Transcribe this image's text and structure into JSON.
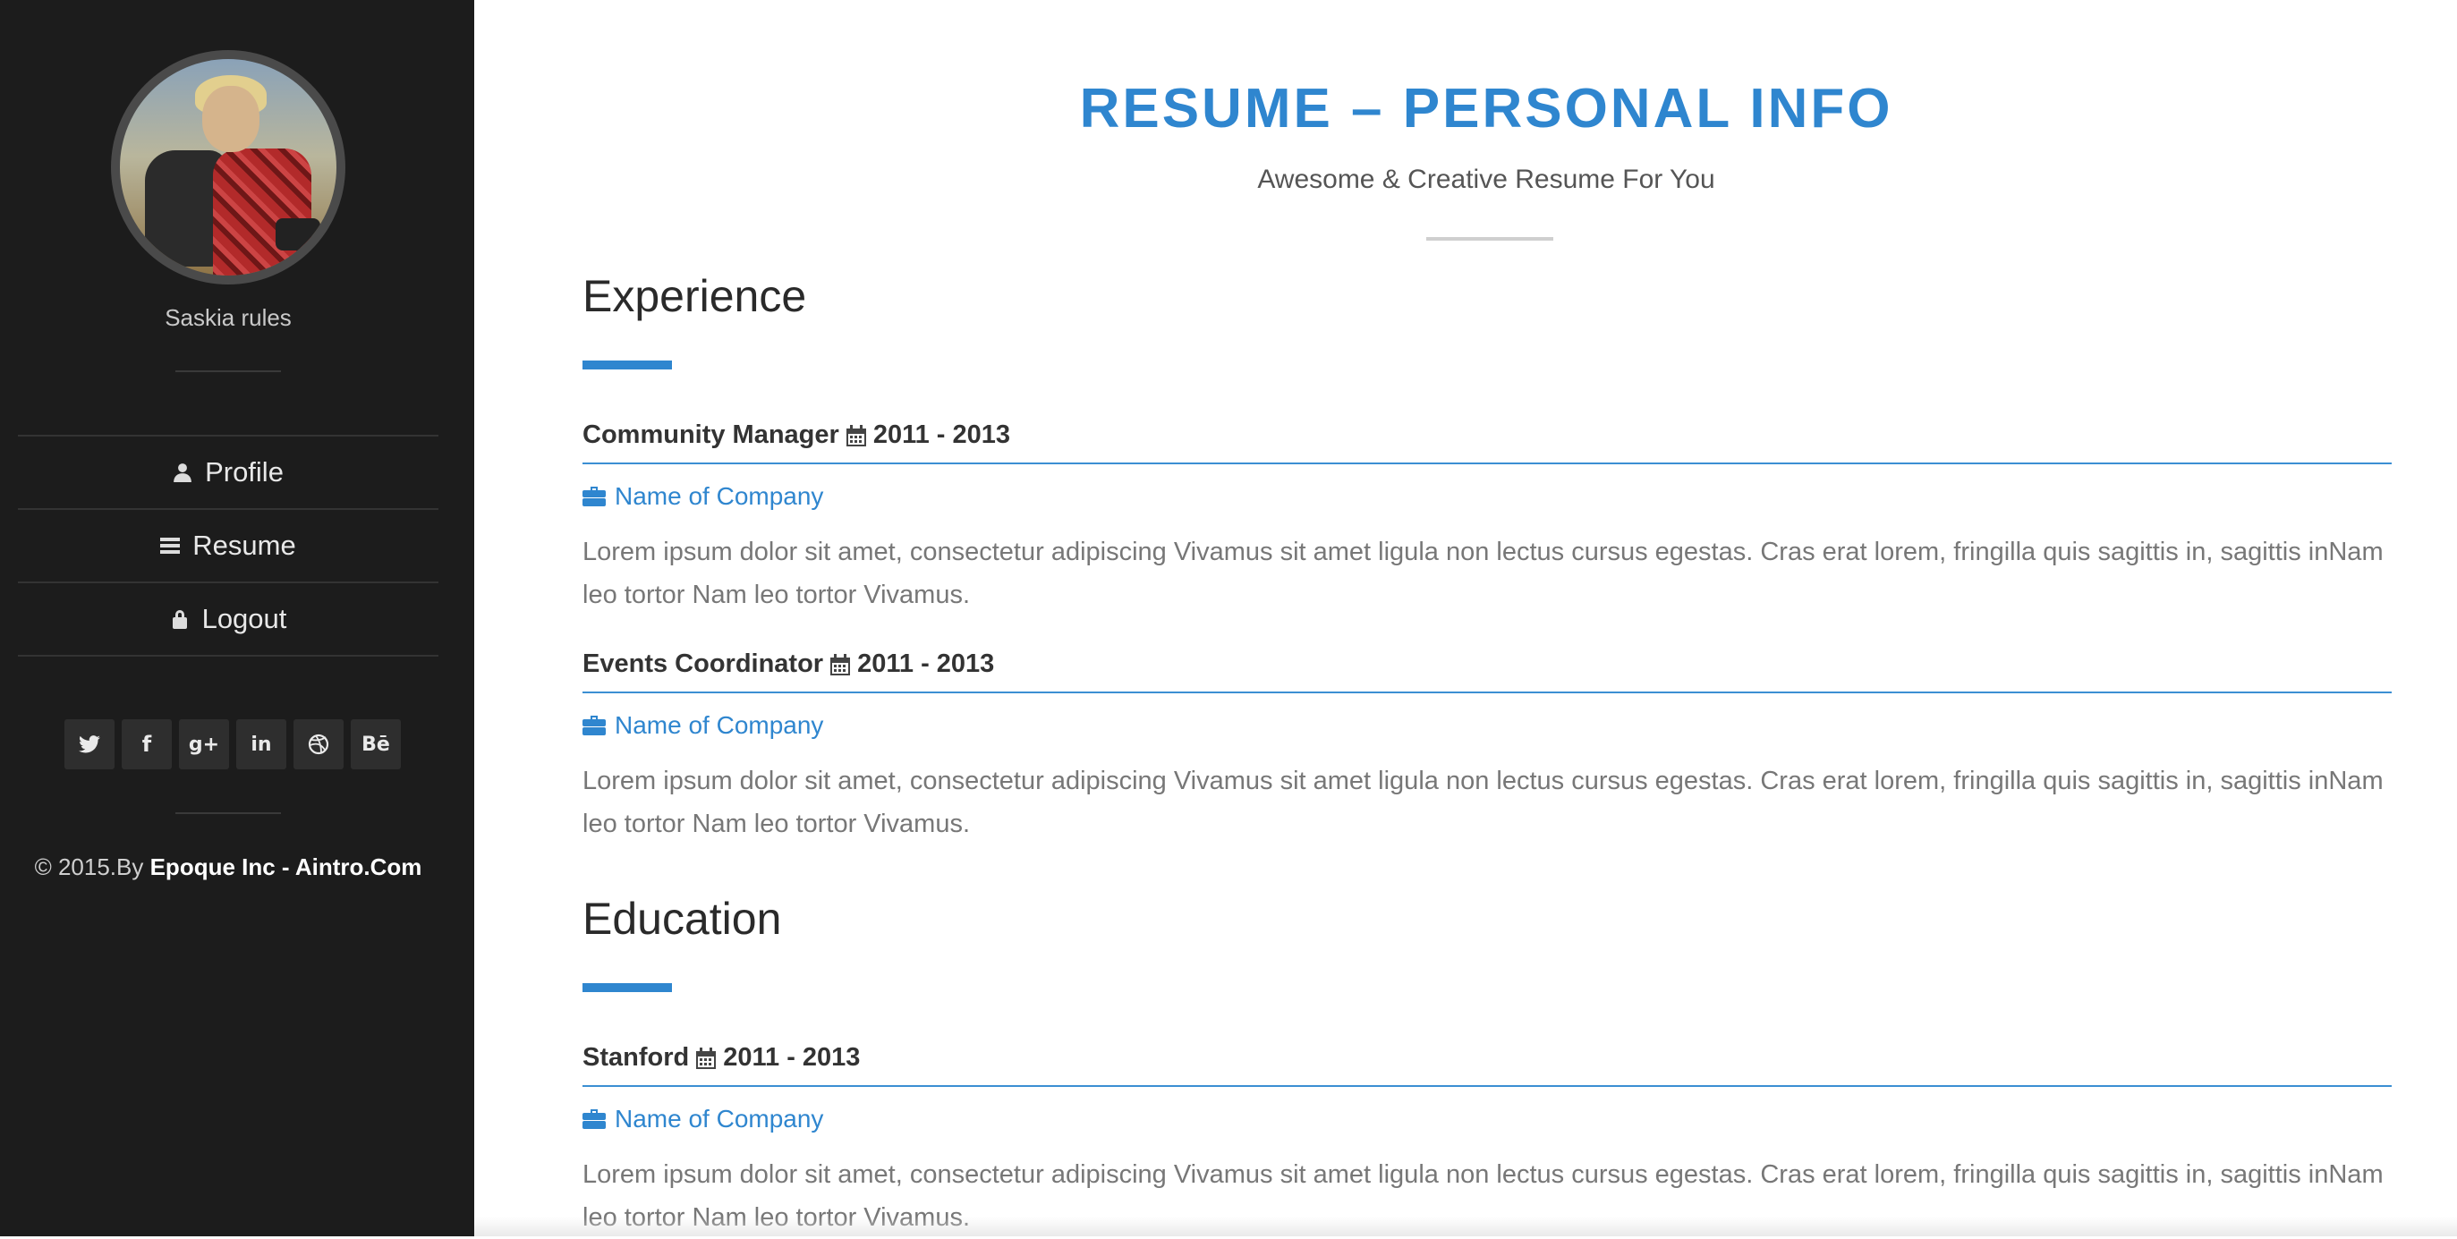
{
  "sidebar": {
    "user_name": "Saskia rules",
    "nav": [
      {
        "label": "Profile",
        "icon": "user-icon"
      },
      {
        "label": "Resume",
        "icon": "list-icon"
      },
      {
        "label": "Logout",
        "icon": "lock-icon"
      }
    ],
    "social": [
      {
        "name": "twitter",
        "glyph": "𝕥"
      },
      {
        "name": "facebook",
        "glyph": "f"
      },
      {
        "name": "google-plus",
        "glyph": "g+"
      },
      {
        "name": "linkedin",
        "glyph": "in"
      },
      {
        "name": "dribbble",
        "glyph": "◎"
      },
      {
        "name": "behance",
        "glyph": "Bē"
      }
    ],
    "footer_prefix": "© 2015.By ",
    "footer_bold": "Epoque Inc - Aintro.Com"
  },
  "main": {
    "title": "RESUME – PERSONAL INFO",
    "subtitle": "Awesome & Creative Resume For You",
    "experience": {
      "heading": "Experience",
      "items": [
        {
          "title": "Community Manager",
          "years": "2011 - 2013",
          "company": "Name of Company",
          "description": "Lorem ipsum dolor sit amet, consectetur adipiscing Vivamus sit amet ligula non lectus cursus egestas. Cras erat lorem, fringilla quis sagittis in, sagittis inNam leo tortor Nam leo tortor Vivamus."
        },
        {
          "title": "Events Coordinator",
          "years": "2011 - 2013",
          "company": "Name of Company",
          "description": "Lorem ipsum dolor sit amet, consectetur adipiscing Vivamus sit amet ligula non lectus cursus egestas. Cras erat lorem, fringilla quis sagittis in, sagittis inNam leo tortor Nam leo tortor Vivamus."
        }
      ]
    },
    "education": {
      "heading": "Education",
      "items": [
        {
          "title": "Stanford",
          "years": "2011 - 2013",
          "company": "Name of Company",
          "description": "Lorem ipsum dolor sit amet, consectetur adipiscing Vivamus sit amet ligula non lectus cursus egestas. Cras erat lorem, fringilla quis sagittis in, sagittis inNam leo tortor Nam leo tortor Vivamus."
        }
      ]
    }
  }
}
